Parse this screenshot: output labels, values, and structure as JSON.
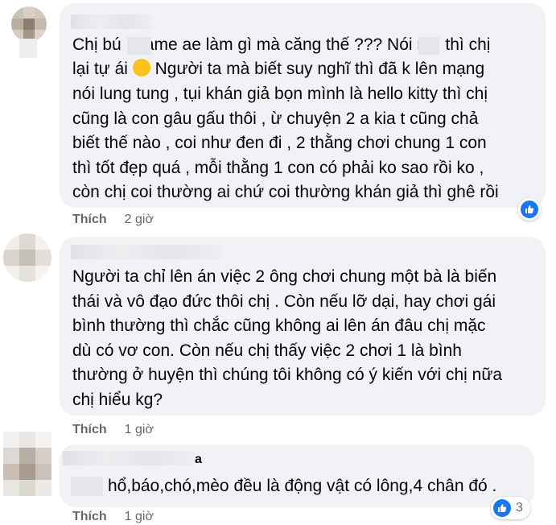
{
  "comments": [
    {
      "lines": [
        "Chị bú    fame ae làm gì mà căng thế ??? Nói n    thì chị",
        "lại tự ái",
        "nói lung tung , tụi khán giả bọn mình là hello kitty thì chị",
        "cũng là con gâu gấu thôi , ừ chuyện 2 a kia t cũng chả",
        "biết thế nào , coi như đen đi , 2 thằng chơi chung 1 con",
        "thì tốt đẹp quá , mỗi thằng 1 con có phải ko sao rồi ko ,",
        "còn chị coi thường ai chứ coi thường khán giả thì ghê rồi"
      ],
      "line2_rest": "Người ta mà biết suy nghĩ thì đã k lên mạng",
      "emoji_icon": "grinning-sweat-emoji",
      "like_label": "Thích",
      "time": "2 giờ"
    },
    {
      "lines": [
        "Người ta chỉ lên án việc 2 ông chơi chung một bà là biến",
        "thái và vô đạo đức thôi chị . Còn nếu lỡ dại, hay chơi gái",
        "bình thường thì chắc cũng không ai lên án đâu chị mặc",
        "dù có vơ con. Còn nếu chị thấy việc 2 chơi 1 là bình",
        "thường ở huyện thì chúng tôi không có ý kiến với chị nữa",
        "chị hiểu kg?"
      ],
      "like_label": "Thích",
      "time": "1 giờ"
    },
    {
      "name_tail": "a",
      "lines": [
        "hổ,báo,chó,mèo đều là động vật có lông,4 chân đó ."
      ],
      "like_label": "Thích",
      "time": "1 giờ",
      "reaction_count": "3"
    }
  ],
  "colors": {
    "like_blue": "#1877f2",
    "bubble": "#f0f2f5",
    "meta": "#65676b"
  }
}
